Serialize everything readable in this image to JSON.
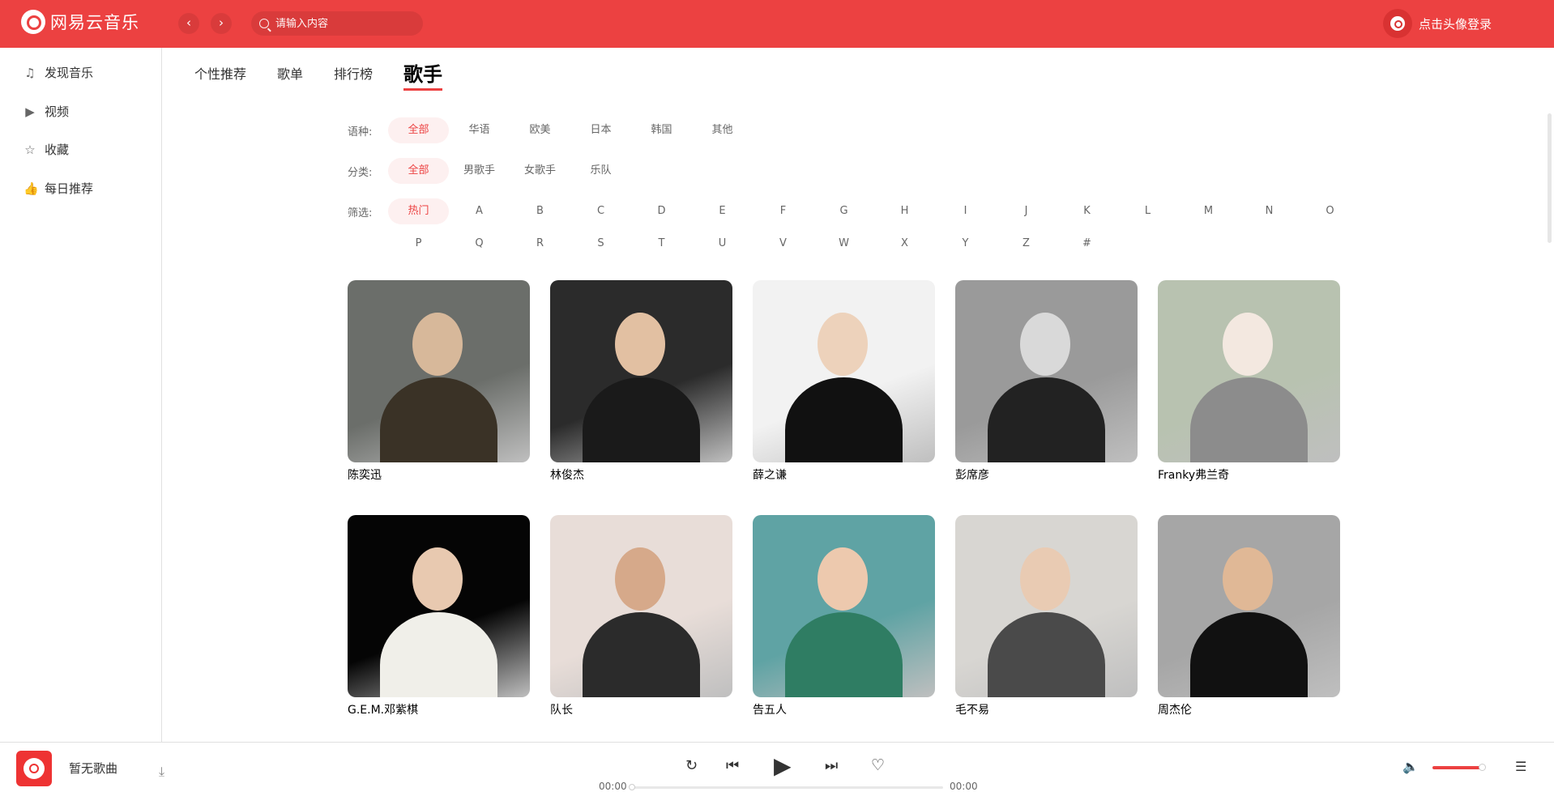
{
  "header": {
    "app_name": "网易云音乐",
    "back_glyph": "‹",
    "forward_glyph": "›",
    "search_placeholder": "请输入内容",
    "login_text": "点击头像登录",
    "accent_color": "#ec4141"
  },
  "sidebar": {
    "items": [
      {
        "label": "发现音乐",
        "icon": "music-note-icon"
      },
      {
        "label": "视频",
        "icon": "video-icon"
      },
      {
        "label": "收藏",
        "icon": "star-icon"
      },
      {
        "label": "每日推荐",
        "icon": "thumbs-up-icon"
      }
    ]
  },
  "tabs": [
    "个性推荐",
    "歌单",
    "排行榜",
    "歌手"
  ],
  "active_tab": "歌手",
  "filters": {
    "language": {
      "label": "语种:",
      "options": [
        "全部",
        "华语",
        "欧美",
        "日本",
        "韩国",
        "其他"
      ],
      "selected": "全部"
    },
    "category": {
      "label": "分类:",
      "options": [
        "全部",
        "男歌手",
        "女歌手",
        "乐队"
      ],
      "selected": "全部"
    },
    "initial": {
      "label": "筛选:",
      "row1": [
        "热门",
        "A",
        "B",
        "C",
        "D",
        "E",
        "F",
        "G",
        "H",
        "I",
        "J",
        "K",
        "L",
        "M",
        "N",
        "O"
      ],
      "row2": [
        "P",
        "Q",
        "R",
        "S",
        "T",
        "U",
        "V",
        "W",
        "X",
        "Y",
        "Z",
        "#"
      ],
      "selected": "热门"
    }
  },
  "artists": [
    {
      "name": "陈奕迅"
    },
    {
      "name": "林俊杰"
    },
    {
      "name": "薛之谦"
    },
    {
      "name": "彭席彦"
    },
    {
      "name": "Franky弗兰奇"
    },
    {
      "name": "G.E.M.邓紫棋"
    },
    {
      "name": "队长"
    },
    {
      "name": "告五人"
    },
    {
      "name": "毛不易"
    },
    {
      "name": "周杰伦"
    }
  ],
  "player": {
    "song_title": "暂无歌曲",
    "current_time": "00:00",
    "total_time": "00:00",
    "progress": 0,
    "volume": 0.9,
    "download_glyph": "⤓",
    "loop_glyph": "↻",
    "prev_glyph": "⏮",
    "play_glyph": "▶",
    "next_glyph": "⏭",
    "like_glyph": "♡",
    "volume_glyph": "🔈",
    "playlist_glyph": "☰"
  }
}
